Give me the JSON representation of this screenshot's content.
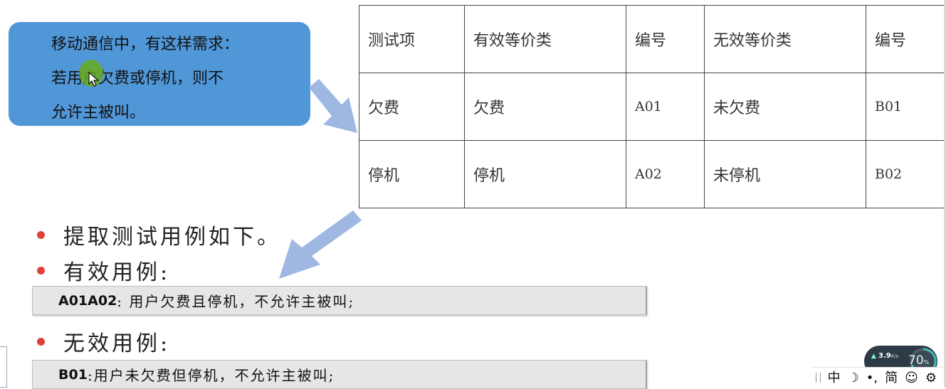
{
  "callout": {
    "lines": [
      "移动通信中，有这样需求：",
      "若用户欠费或停机，则不",
      "允许主被叫。"
    ]
  },
  "table": {
    "headers": [
      "测试项",
      "有效等价类",
      "编号",
      "无效等价类",
      "编号"
    ],
    "rows": [
      [
        "欠费",
        "欠费",
        "A01",
        "未欠费",
        "B01"
      ],
      [
        "停机",
        "停机",
        "A02",
        "未停机",
        "B02"
      ]
    ]
  },
  "bullets": {
    "extract": "提取测试用例如下。",
    "valid": "有效用例:",
    "invalid": "无效用例:"
  },
  "cases": {
    "valid_case_id": "A01A02",
    "valid_case_text": ": 用户欠费且停机，不允许主被叫;",
    "invalid_case_id": "B01",
    "invalid_case_text": ":用户未欠费但停机，不允许主被叫;"
  },
  "tray": {
    "speed_value": "3.9",
    "speed_unit": "K/s",
    "gauge_value": "70",
    "gauge_unit": "%",
    "ime_items": [
      "中",
      "☽",
      "•,",
      "简",
      "☺",
      "⚙"
    ]
  },
  "colors": {
    "callout_bg": "#5097d8",
    "arrow": "#9fb8e2",
    "bullet_dot": "#e0403a",
    "case_bg": "#e6e6e6"
  },
  "icons": [
    "mouse-cursor-icon",
    "arrow-down-right-icon",
    "arrow-down-left-icon",
    "upload-icon",
    "gear-icon"
  ]
}
